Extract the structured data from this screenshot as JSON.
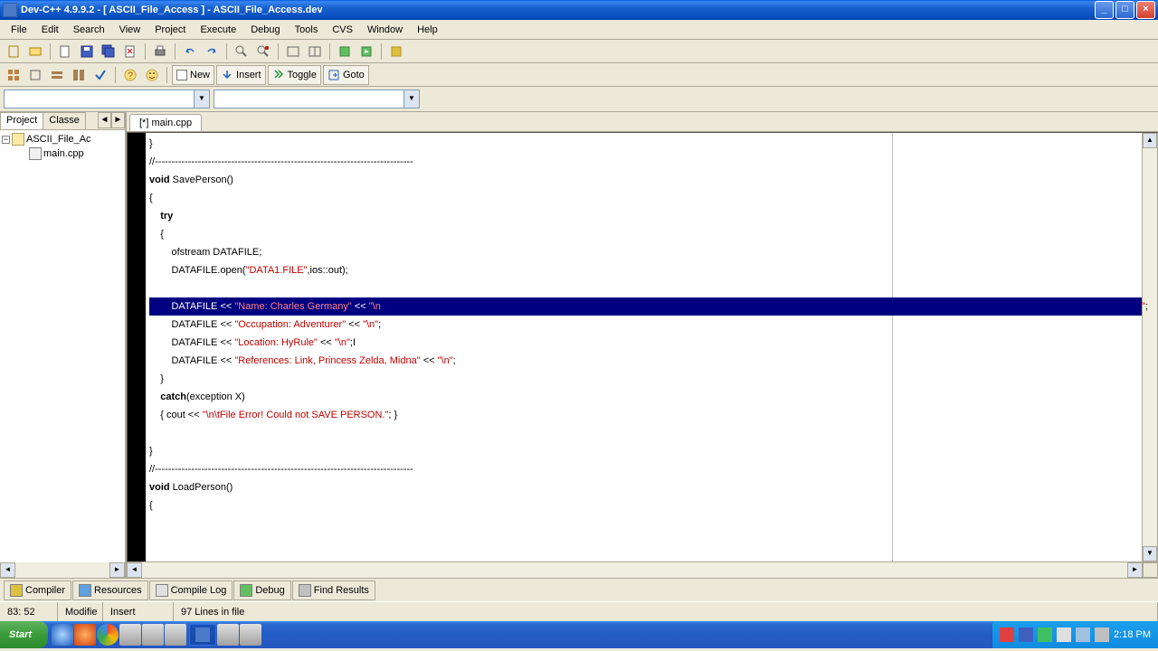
{
  "title": "Dev-C++ 4.9.9.2 - [ ASCII_File_Access ] - ASCII_File_Access.dev",
  "menus": [
    "File",
    "Edit",
    "Search",
    "View",
    "Project",
    "Execute",
    "Debug",
    "Tools",
    "CVS",
    "Window",
    "Help"
  ],
  "toolbar2": {
    "new": "New",
    "insert": "Insert",
    "toggle": "Toggle",
    "goto": "Goto"
  },
  "sidebar": {
    "tabs": [
      "Project",
      "Classe"
    ],
    "project_name": "ASCII_File_Ac",
    "file": "main.cpp"
  },
  "editor": {
    "tab": "[*] main.cpp"
  },
  "code": {
    "l1": "}",
    "l2": "//------------------------------------------------------------------------------",
    "l3a": "void",
    "l3b": " SavePerson()",
    "l4": "{",
    "l5a": "    ",
    "l5b": "try",
    "l6": "    {",
    "l7": "        ofstream DATAFILE;",
    "l8a": "        DATAFILE.open(",
    "l8b": "\"DATA1.FILE\"",
    "l8c": ",ios::out);",
    "l9_blank": "",
    "l10a": "        DATAFILE << ",
    "l10b": "\"Name: Charles Germany\"",
    "l10c": " << ",
    "l10d": "\"\\n",
    "l10e": "\"",
    "l10f": ";",
    "l11a": "        DATAFILE << ",
    "l11b": "\"Occupation: Adventurer\"",
    "l11c": " << ",
    "l11d": "\"\\n\"",
    "l11e": ";",
    "l12a": "        DATAFILE << ",
    "l12b": "\"Location: HyRule\"",
    "l12c": " << ",
    "l12d": "\"\\n\"",
    "l12e": ";",
    "l13a": "        DATAFILE << ",
    "l13b": "\"References: Link, Princess Zelda, Midna\"",
    "l13c": " << ",
    "l13d": "\"\\n\"",
    "l13e": ";",
    "l14": "    }",
    "l15a": "    ",
    "l15b": "catch",
    "l15c": "(exception X)",
    "l16a": "    { cout << ",
    "l16b": "\"\\n\\tFile Error! Could not SAVE PERSON.\"",
    "l16c": "; }",
    "l17": "",
    "l18": "}",
    "l19": "//------------------------------------------------------------------------------",
    "l20a": "void",
    "l20b": " LoadPerson()",
    "l21": "{"
  },
  "bottom_tabs": {
    "compiler": "Compiler",
    "resources": "Resources",
    "log": "Compile Log",
    "debug": "Debug",
    "find": "Find Results"
  },
  "status": {
    "pos": "83: 52",
    "modified": "Modifie",
    "insert": "Insert",
    "lines": "97 Lines in file"
  },
  "taskbar": {
    "start": "Start",
    "time": "2:18 PM"
  }
}
